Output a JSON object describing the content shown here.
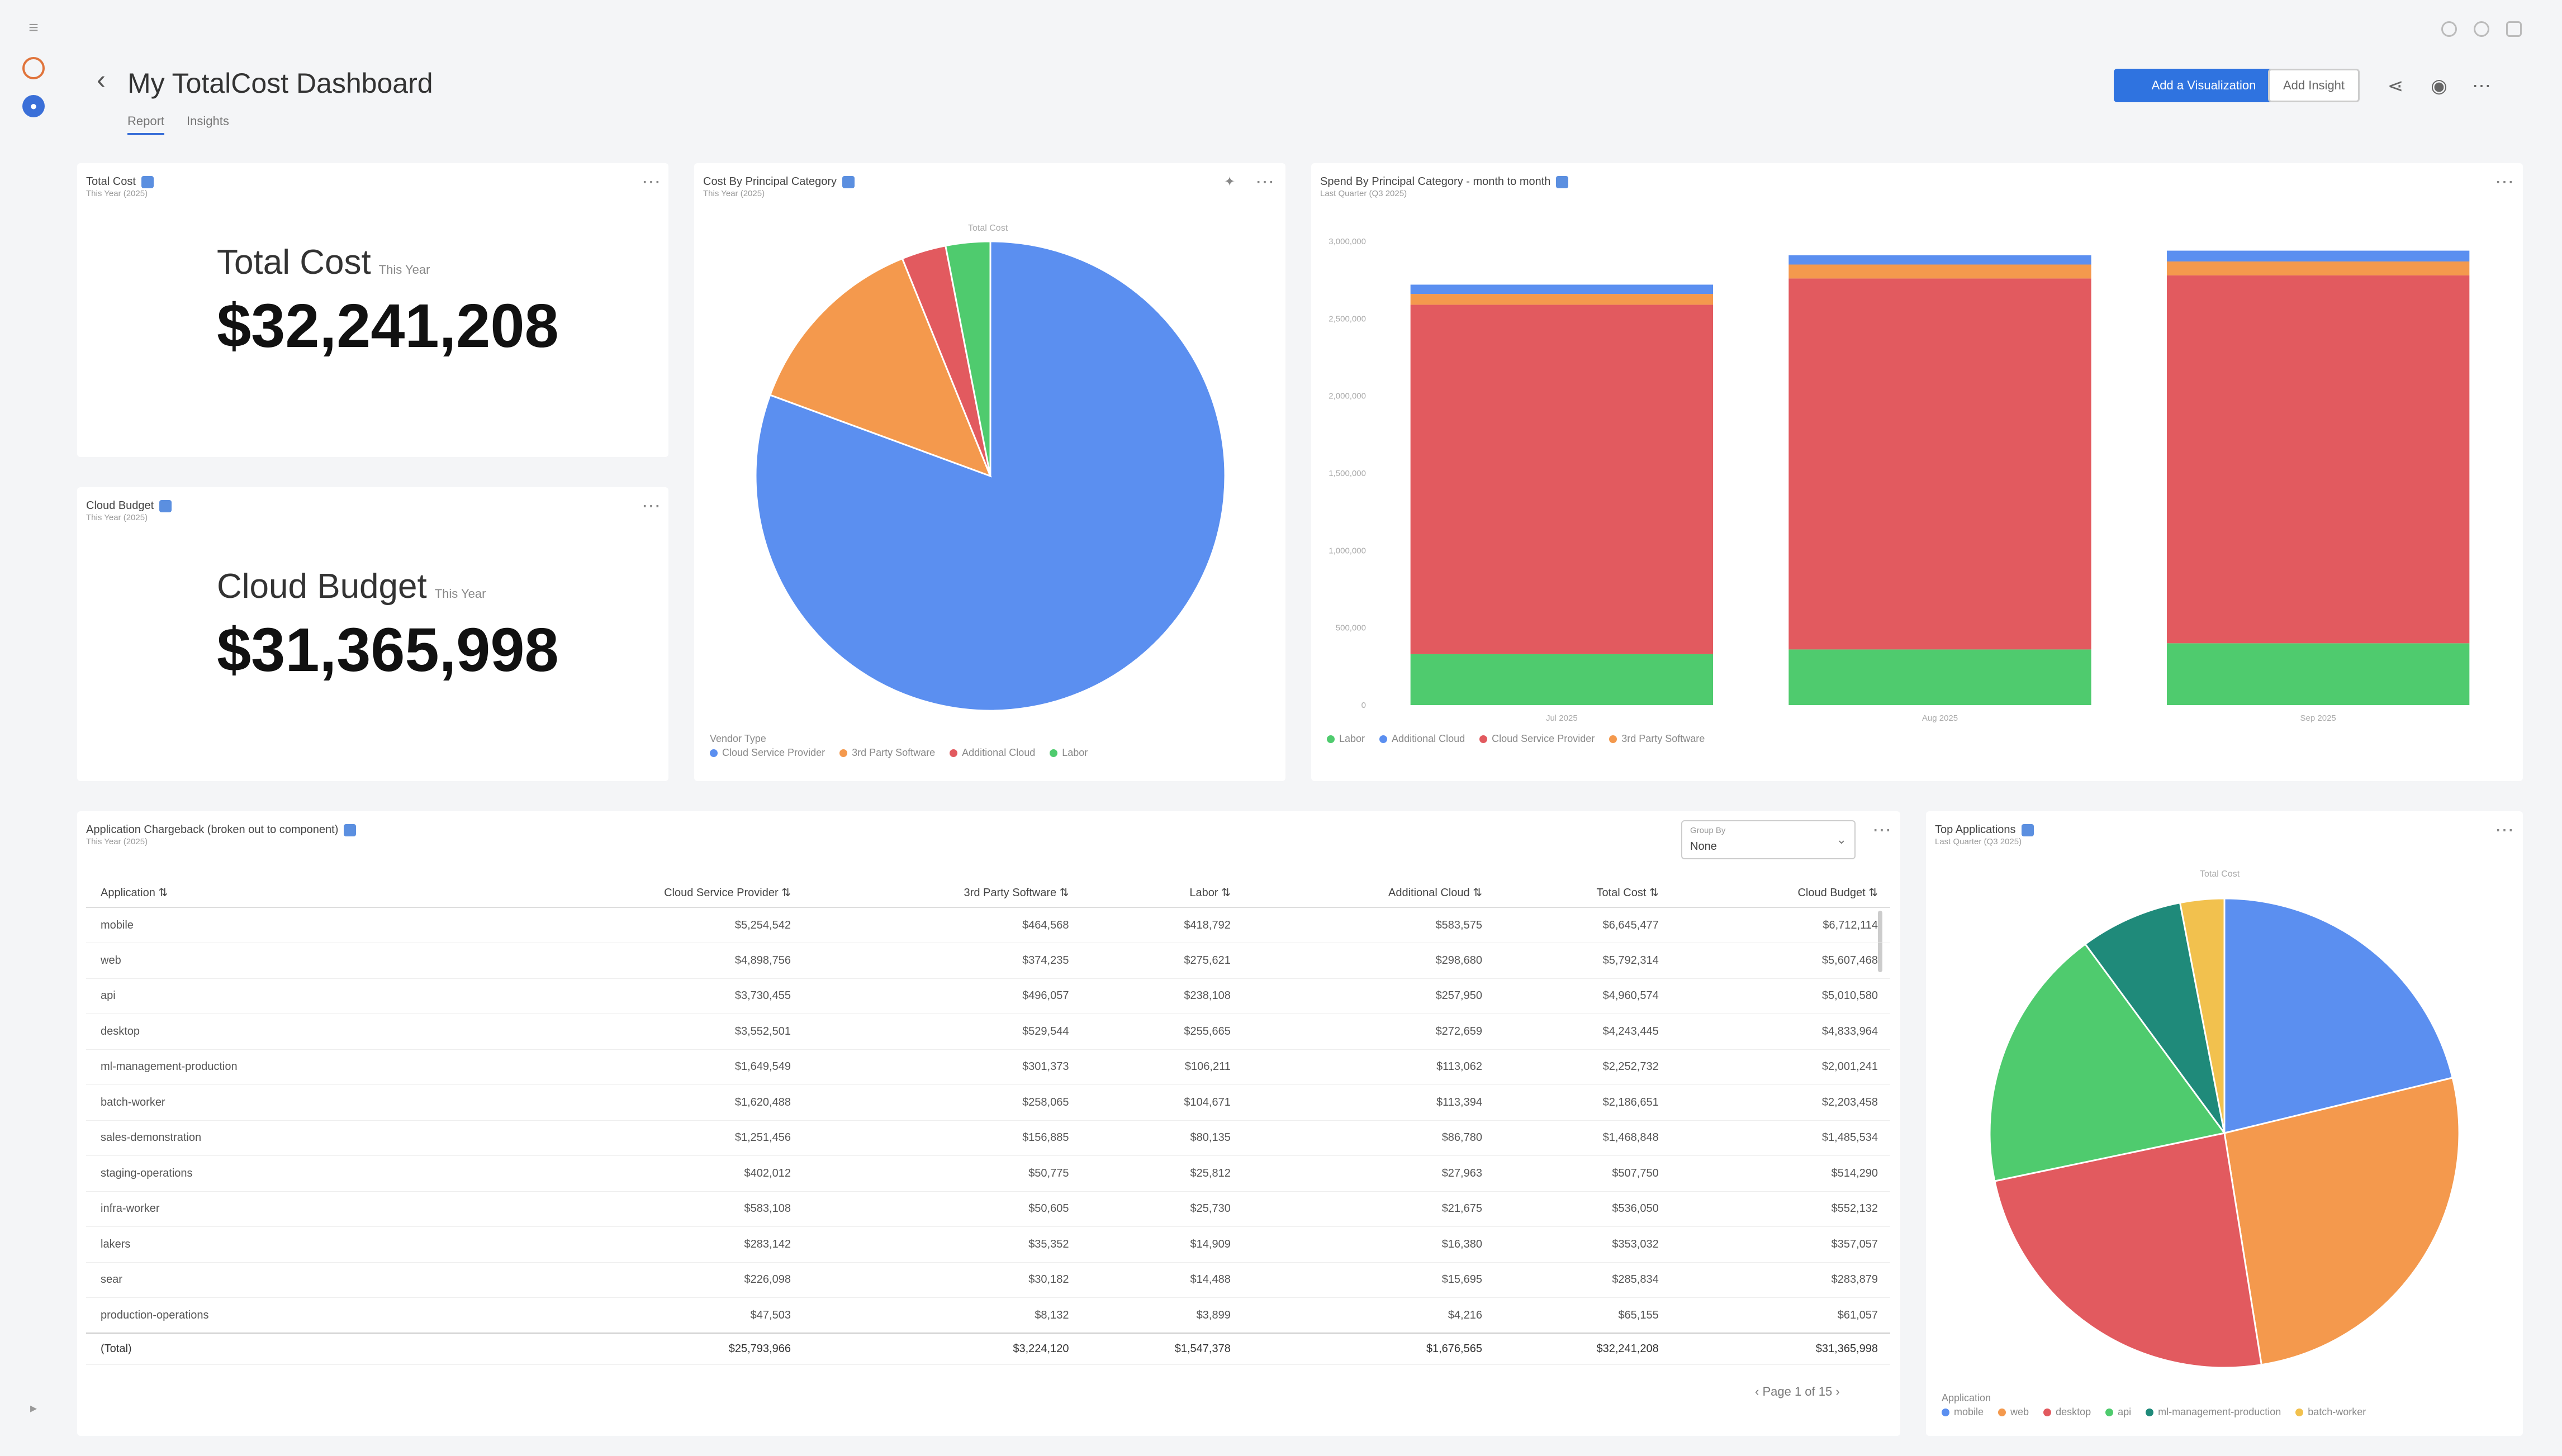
{
  "header": {
    "title": "My TotalCost Dashboard",
    "tabs": [
      {
        "label": "Report"
      },
      {
        "label": "Insights"
      }
    ],
    "primary_button": "Add a Visualization",
    "secondary_button": "Add Insight",
    "icons": [
      "share-icon",
      "eye-icon",
      "more-icon"
    ]
  },
  "kpis": [
    {
      "card_title": "Total Cost",
      "card_subtitle": "This Year (2025)",
      "label": "Total Cost",
      "period": "This Year",
      "value": "$32,241,208"
    },
    {
      "card_title": "Cloud Budget",
      "card_subtitle": "This Year (2025)",
      "label": "Cloud Budget",
      "period": "This Year",
      "value": "$31,365,998"
    }
  ],
  "pie_principal": {
    "card_title": "Cost By Principal Category",
    "card_subtitle": "This Year (2025)",
    "center_label": "Total Cost",
    "legend_title": "Vendor Type",
    "colors": [
      "#5b8ff0",
      "#f4994d",
      "#e25a5f",
      "#4fcb6e"
    ],
    "labels": [
      "Cloud Service Provider",
      "3rd Party Software",
      "Additional Cloud",
      "Labor"
    ],
    "values": [
      79,
      13,
      3,
      3
    ]
  },
  "bar_monthly": {
    "card_title": "Spend By Principal Category - month to month",
    "card_subtitle": "Last Quarter (Q3 2025)",
    "categories": [
      "Jul 2025",
      "Aug 2025",
      "Sep 2025"
    ],
    "y_ticks": [
      "3,000,000",
      "2,500,000",
      "2,000,000",
      "1,500,000",
      "1,000,000",
      "500,000",
      "0"
    ],
    "ymax": 3000000,
    "series": [
      {
        "name": "Labor",
        "color": "#4fcb6e",
        "values": [
          330000,
          360000,
          400000
        ]
      },
      {
        "name": "Cloud Service Provider",
        "color": "#e25a5f",
        "values": [
          2260000,
          2400000,
          2380000
        ]
      },
      {
        "name": "3rd Party Software",
        "color": "#f4994d",
        "values": [
          70000,
          90000,
          90000
        ]
      },
      {
        "name": "Additional Cloud",
        "color": "#5b8ff0",
        "values": [
          60000,
          60000,
          70000
        ]
      }
    ],
    "legend": [
      "Labor",
      "Additional Cloud",
      "Cloud Service Provider",
      "3rd Party Software"
    ],
    "legend_colors": [
      "#4fcb6e",
      "#5b8ff0",
      "#e25a5f",
      "#f4994d"
    ]
  },
  "table": {
    "card_title": "Application Chargeback (broken out to component)",
    "card_subtitle": "This Year (2025)",
    "group_by_label": "Group By",
    "group_by_value": "None",
    "columns": [
      "Application",
      "Cloud Service Provider",
      "3rd Party Software",
      "Labor",
      "Additional Cloud",
      "Total Cost",
      "Cloud Budget"
    ],
    "rows": [
      [
        "mobile",
        "$5,254,542",
        "$464,568",
        "$418,792",
        "$583,575",
        "$6,645,477",
        "$6,712,114"
      ],
      [
        "web",
        "$4,898,756",
        "$374,235",
        "$275,621",
        "$298,680",
        "$5,792,314",
        "$5,607,468"
      ],
      [
        "api",
        "$3,730,455",
        "$496,057",
        "$238,108",
        "$257,950",
        "$4,960,574",
        "$5,010,580"
      ],
      [
        "desktop",
        "$3,552,501",
        "$529,544",
        "$255,665",
        "$272,659",
        "$4,243,445",
        "$4,833,964"
      ],
      [
        "ml-management-production",
        "$1,649,549",
        "$301,373",
        "$106,211",
        "$113,062",
        "$2,252,732",
        "$2,001,241"
      ],
      [
        "batch-worker",
        "$1,620,488",
        "$258,065",
        "$104,671",
        "$113,394",
        "$2,186,651",
        "$2,203,458"
      ],
      [
        "sales-demonstration",
        "$1,251,456",
        "$156,885",
        "$80,135",
        "$86,780",
        "$1,468,848",
        "$1,485,534"
      ],
      [
        "staging-operations",
        "$402,012",
        "$50,775",
        "$25,812",
        "$27,963",
        "$507,750",
        "$514,290"
      ],
      [
        "infra-worker",
        "$583,108",
        "$50,605",
        "$25,730",
        "$21,675",
        "$536,050",
        "$552,132"
      ],
      [
        "lakers",
        "$283,142",
        "$35,352",
        "$14,909",
        "$16,380",
        "$353,032",
        "$357,057"
      ],
      [
        "sear",
        "$226,098",
        "$30,182",
        "$14,488",
        "$15,695",
        "$285,834",
        "$283,879"
      ],
      [
        "production-operations",
        "$47,503",
        "$8,132",
        "$3,899",
        "$4,216",
        "$65,155",
        "$61,057"
      ]
    ],
    "total": [
      "(Total)",
      "$25,793,966",
      "$3,224,120",
      "$1,547,378",
      "$1,676,565",
      "$32,241,208",
      "$31,365,998"
    ],
    "pager": "Page 1 of 15"
  },
  "pie_apps": {
    "card_title": "Top Applications",
    "card_subtitle": "Last Quarter (Q3 2025)",
    "center_label": "Total Cost",
    "legend_title": "Application",
    "colors": [
      "#5b8ff0",
      "#f4994d",
      "#e25a5f",
      "#4fcb6e",
      "#1f8a7a",
      "#f2c14e"
    ],
    "labels": [
      "mobile",
      "web",
      "desktop",
      "api",
      "ml-management-production",
      "batch-worker"
    ],
    "values": [
      21,
      26,
      24,
      18,
      7,
      3
    ]
  }
}
